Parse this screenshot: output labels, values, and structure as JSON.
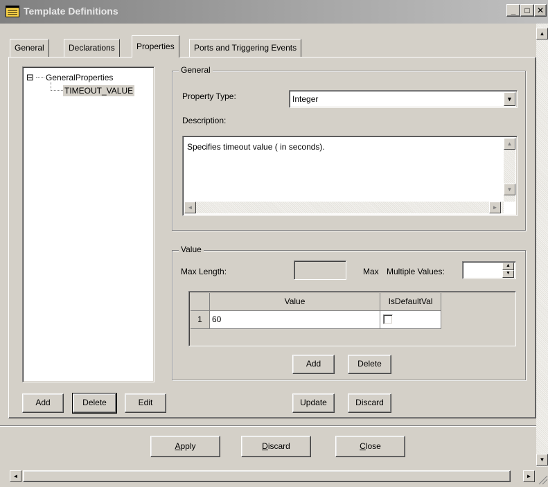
{
  "window": {
    "title": "Template Definitions",
    "minimize": "_",
    "maximize": "□",
    "close": "✕"
  },
  "tabs": [
    {
      "label": "General"
    },
    {
      "label": "Declarations"
    },
    {
      "label": "Properties",
      "active": true
    },
    {
      "label": "Ports and Triggering Events"
    }
  ],
  "tree": {
    "root": "GeneralProperties",
    "root_toggle": "⊟",
    "child": "TIMEOUT_VALUE"
  },
  "tree_buttons": {
    "add": "Add",
    "delete": "Delete",
    "edit": "Edit"
  },
  "general_group": {
    "label": "General",
    "property_type_label": "Property Type:",
    "property_type_value": "Integer",
    "description_label": "Description:",
    "description_value": "Specifies timeout value ( in seconds)."
  },
  "value_group": {
    "label": "Value",
    "max_length_label": "Max Length:",
    "max_length_value": "",
    "max_multiple_prefix": "Max",
    "max_multiple_label": "Multiple Values:",
    "max_multiple_value": "",
    "grid": {
      "columns": [
        "Value",
        "IsDefaultVal"
      ],
      "rows": [
        {
          "index": "1",
          "value": "60",
          "is_default": false
        }
      ]
    },
    "add_label": "Add",
    "delete_label": "Delete"
  },
  "property_buttons": {
    "update": "Update",
    "discard": "Discard"
  },
  "bottom_buttons": {
    "apply_mnemonic": "A",
    "apply_rest": "pply",
    "discard_mnemonic": "D",
    "discard_rest": "iscard",
    "close_mnemonic": "C",
    "close_rest": "lose"
  },
  "icons": {
    "title": "window-icon",
    "arrows": "▲▼◄►"
  }
}
